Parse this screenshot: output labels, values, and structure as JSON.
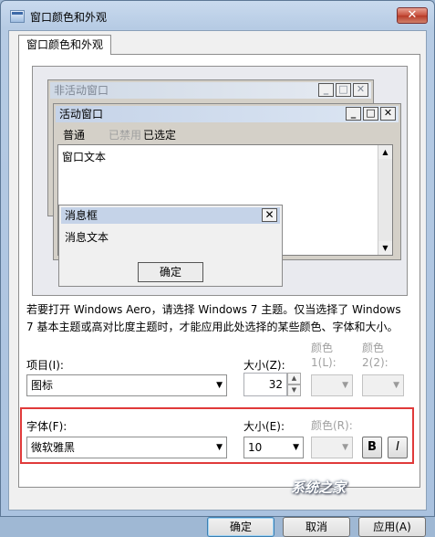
{
  "window": {
    "title": "窗口颜色和外观",
    "close_glyph": "✕"
  },
  "tabs": [
    {
      "label": "窗口颜色和外观"
    }
  ],
  "preview": {
    "inactive_title": "非活动窗口",
    "active_title": "活动窗口",
    "menu": {
      "normal": "普通",
      "disabled": "已禁用",
      "selected": "已选定"
    },
    "window_text": "窗口文本",
    "msgbox_title": "消息框",
    "msgbox_text": "消息文本",
    "msgbox_ok": "确定",
    "caption_buttons": [
      "_",
      "□",
      "✕"
    ]
  },
  "description": "若要打开 Windows Aero，请选择 Windows 7 主题。仅当选择了 Windows 7 基本主题或高对比度主题时，才能应用此处选择的某些颜色、字体和大小。",
  "item": {
    "label": "项目(I):",
    "value": "图标",
    "size_label": "大小(Z):",
    "size_value": "32",
    "color1_label": "颜色 1(L):",
    "color2_label": "颜色 2(2):"
  },
  "font": {
    "label": "字体(F):",
    "value": "微软雅黑",
    "size_label": "大小(E):",
    "size_value": "10",
    "color_label": "颜色(R):",
    "bold": "B",
    "italic": "I"
  },
  "buttons": {
    "ok": "确定",
    "cancel": "取消",
    "apply": "应用(A)"
  },
  "watermark": "系统之家",
  "colors": {
    "highlight_border": "#e03a3a",
    "active_title": "#c5d3e8"
  }
}
